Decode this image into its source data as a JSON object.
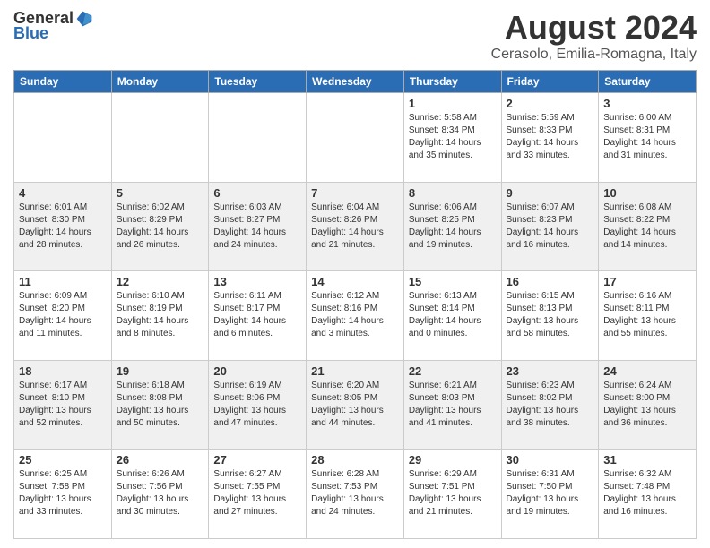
{
  "logo": {
    "general": "General",
    "blue": "Blue"
  },
  "header": {
    "title": "August 2024",
    "subtitle": "Cerasolo, Emilia-Romagna, Italy"
  },
  "days_of_week": [
    "Sunday",
    "Monday",
    "Tuesday",
    "Wednesday",
    "Thursday",
    "Friday",
    "Saturday"
  ],
  "weeks": [
    [
      {
        "day": "",
        "info": ""
      },
      {
        "day": "",
        "info": ""
      },
      {
        "day": "",
        "info": ""
      },
      {
        "day": "",
        "info": ""
      },
      {
        "day": "1",
        "info": "Sunrise: 5:58 AM\nSunset: 8:34 PM\nDaylight: 14 hours\nand 35 minutes."
      },
      {
        "day": "2",
        "info": "Sunrise: 5:59 AM\nSunset: 8:33 PM\nDaylight: 14 hours\nand 33 minutes."
      },
      {
        "day": "3",
        "info": "Sunrise: 6:00 AM\nSunset: 8:31 PM\nDaylight: 14 hours\nand 31 minutes."
      }
    ],
    [
      {
        "day": "4",
        "info": "Sunrise: 6:01 AM\nSunset: 8:30 PM\nDaylight: 14 hours\nand 28 minutes."
      },
      {
        "day": "5",
        "info": "Sunrise: 6:02 AM\nSunset: 8:29 PM\nDaylight: 14 hours\nand 26 minutes."
      },
      {
        "day": "6",
        "info": "Sunrise: 6:03 AM\nSunset: 8:27 PM\nDaylight: 14 hours\nand 24 minutes."
      },
      {
        "day": "7",
        "info": "Sunrise: 6:04 AM\nSunset: 8:26 PM\nDaylight: 14 hours\nand 21 minutes."
      },
      {
        "day": "8",
        "info": "Sunrise: 6:06 AM\nSunset: 8:25 PM\nDaylight: 14 hours\nand 19 minutes."
      },
      {
        "day": "9",
        "info": "Sunrise: 6:07 AM\nSunset: 8:23 PM\nDaylight: 14 hours\nand 16 minutes."
      },
      {
        "day": "10",
        "info": "Sunrise: 6:08 AM\nSunset: 8:22 PM\nDaylight: 14 hours\nand 14 minutes."
      }
    ],
    [
      {
        "day": "11",
        "info": "Sunrise: 6:09 AM\nSunset: 8:20 PM\nDaylight: 14 hours\nand 11 minutes."
      },
      {
        "day": "12",
        "info": "Sunrise: 6:10 AM\nSunset: 8:19 PM\nDaylight: 14 hours\nand 8 minutes."
      },
      {
        "day": "13",
        "info": "Sunrise: 6:11 AM\nSunset: 8:17 PM\nDaylight: 14 hours\nand 6 minutes."
      },
      {
        "day": "14",
        "info": "Sunrise: 6:12 AM\nSunset: 8:16 PM\nDaylight: 14 hours\nand 3 minutes."
      },
      {
        "day": "15",
        "info": "Sunrise: 6:13 AM\nSunset: 8:14 PM\nDaylight: 14 hours\nand 0 minutes."
      },
      {
        "day": "16",
        "info": "Sunrise: 6:15 AM\nSunset: 8:13 PM\nDaylight: 13 hours\nand 58 minutes."
      },
      {
        "day": "17",
        "info": "Sunrise: 6:16 AM\nSunset: 8:11 PM\nDaylight: 13 hours\nand 55 minutes."
      }
    ],
    [
      {
        "day": "18",
        "info": "Sunrise: 6:17 AM\nSunset: 8:10 PM\nDaylight: 13 hours\nand 52 minutes."
      },
      {
        "day": "19",
        "info": "Sunrise: 6:18 AM\nSunset: 8:08 PM\nDaylight: 13 hours\nand 50 minutes."
      },
      {
        "day": "20",
        "info": "Sunrise: 6:19 AM\nSunset: 8:06 PM\nDaylight: 13 hours\nand 47 minutes."
      },
      {
        "day": "21",
        "info": "Sunrise: 6:20 AM\nSunset: 8:05 PM\nDaylight: 13 hours\nand 44 minutes."
      },
      {
        "day": "22",
        "info": "Sunrise: 6:21 AM\nSunset: 8:03 PM\nDaylight: 13 hours\nand 41 minutes."
      },
      {
        "day": "23",
        "info": "Sunrise: 6:23 AM\nSunset: 8:02 PM\nDaylight: 13 hours\nand 38 minutes."
      },
      {
        "day": "24",
        "info": "Sunrise: 6:24 AM\nSunset: 8:00 PM\nDaylight: 13 hours\nand 36 minutes."
      }
    ],
    [
      {
        "day": "25",
        "info": "Sunrise: 6:25 AM\nSunset: 7:58 PM\nDaylight: 13 hours\nand 33 minutes."
      },
      {
        "day": "26",
        "info": "Sunrise: 6:26 AM\nSunset: 7:56 PM\nDaylight: 13 hours\nand 30 minutes."
      },
      {
        "day": "27",
        "info": "Sunrise: 6:27 AM\nSunset: 7:55 PM\nDaylight: 13 hours\nand 27 minutes."
      },
      {
        "day": "28",
        "info": "Sunrise: 6:28 AM\nSunset: 7:53 PM\nDaylight: 13 hours\nand 24 minutes."
      },
      {
        "day": "29",
        "info": "Sunrise: 6:29 AM\nSunset: 7:51 PM\nDaylight: 13 hours\nand 21 minutes."
      },
      {
        "day": "30",
        "info": "Sunrise: 6:31 AM\nSunset: 7:50 PM\nDaylight: 13 hours\nand 19 minutes."
      },
      {
        "day": "31",
        "info": "Sunrise: 6:32 AM\nSunset: 7:48 PM\nDaylight: 13 hours\nand 16 minutes."
      }
    ]
  ]
}
